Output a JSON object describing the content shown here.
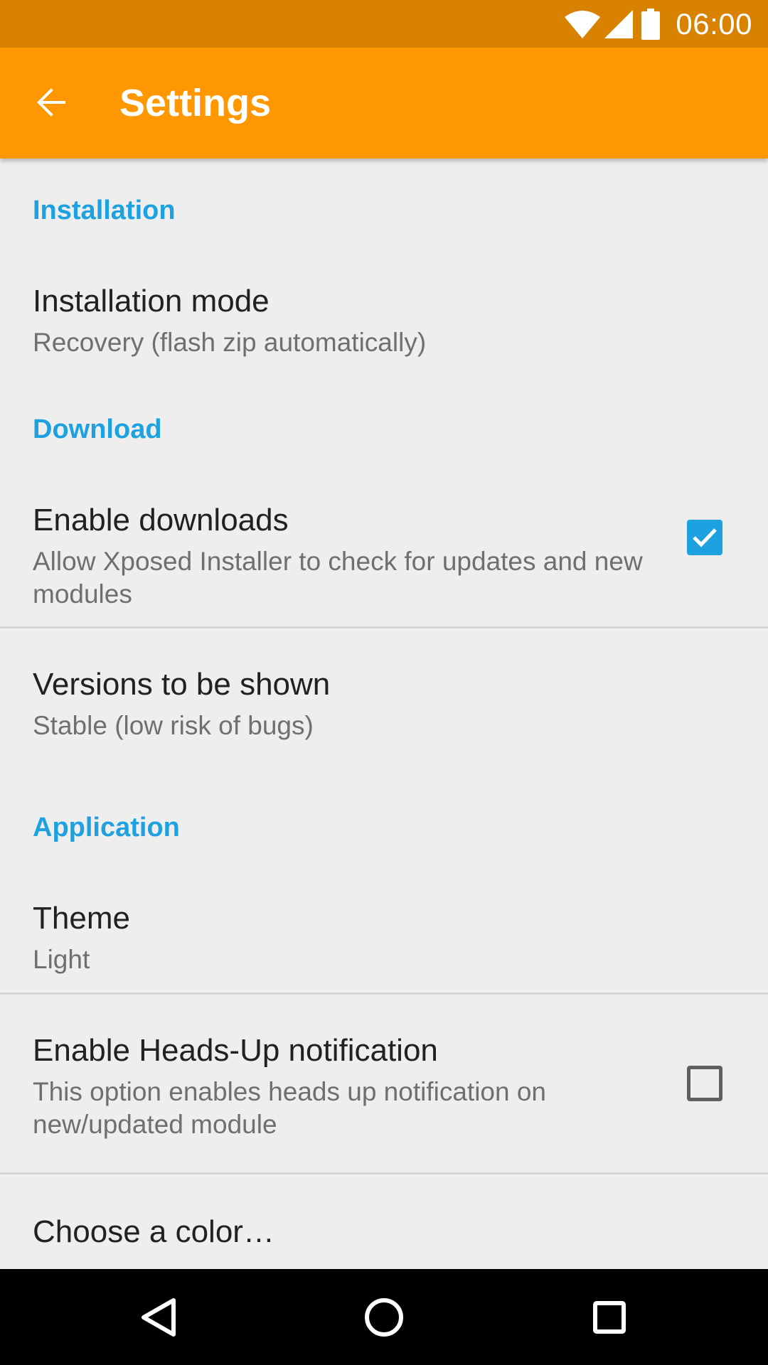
{
  "status_bar": {
    "time": "06:00",
    "icons": [
      "wifi-icon",
      "cell-signal-icon",
      "battery-icon"
    ],
    "color": "#d98100"
  },
  "app_bar": {
    "title": "Settings",
    "back_icon": "arrow-back-icon",
    "color": "#ff9800"
  },
  "sections": {
    "installation": {
      "header": "Installation",
      "installation_mode": {
        "title": "Installation mode",
        "summary": "Recovery (flash zip automatically)"
      }
    },
    "download": {
      "header": "Download",
      "enable_downloads": {
        "title": "Enable downloads",
        "summary": "Allow Xposed Installer to check for updates and new modules",
        "checked": true
      },
      "versions": {
        "title": "Versions to be shown",
        "summary": "Stable (low risk of bugs)"
      }
    },
    "application": {
      "header": "Application",
      "theme": {
        "title": "Theme",
        "summary": "Light"
      },
      "heads_up": {
        "title": "Enable Heads-Up notification",
        "summary": "This option enables heads up notification on new/updated module",
        "checked": false
      },
      "color": {
        "title": "Choose a color…"
      }
    }
  },
  "nav_bar": {
    "icons": [
      "nav-back-icon",
      "nav-home-icon",
      "nav-recents-icon"
    ]
  },
  "accent_color": "#1ea1e0"
}
